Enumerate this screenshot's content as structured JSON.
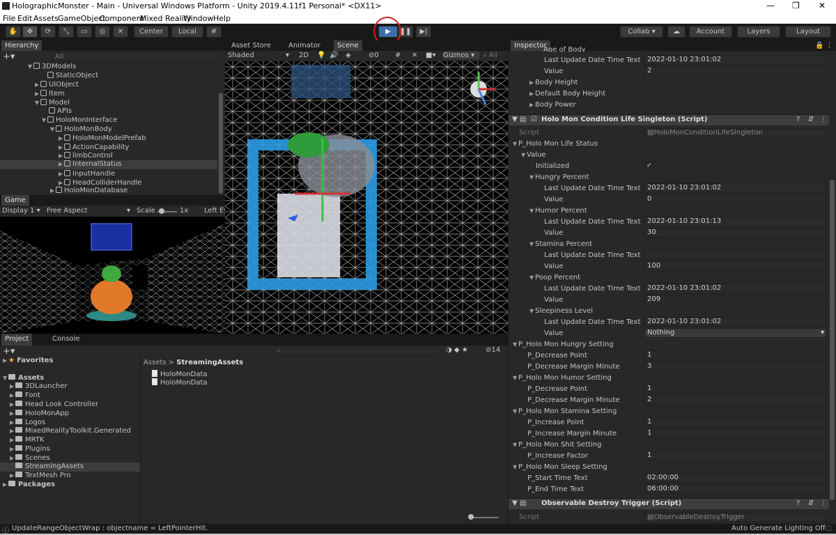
{
  "window": {
    "title": "HolographicMonster - Main - Universal Windows Platform - Unity 2019.4.11f1 Personal* <DX11>",
    "min": "—",
    "max": "❐",
    "close": "✕"
  },
  "menu": [
    "File",
    "Edit",
    "Assets",
    "GameObject",
    "Component",
    "Mixed Reality",
    "Window",
    "Help"
  ],
  "toolbar": {
    "center": "Center",
    "local": "Local",
    "collab": "Collab ▾",
    "account": "Account",
    "layers": "Layers",
    "layout": "Layout"
  },
  "hierarchy": {
    "tab": "Hierarchy",
    "search_placeholder": "All",
    "items": [
      "3DModels",
      "StaticObject",
      "UIObject",
      "Item",
      "Model",
      "APIs",
      "HoloMonInterface",
      "HoloMonBody",
      "HoloMonModelPrefab",
      "ActionCapability",
      "limbControl",
      "InternalStatus",
      "InputHandle",
      "HeadColliderHandle",
      "HoloMonDatabase"
    ]
  },
  "game": {
    "tab": "Game",
    "display": "Display 1",
    "aspect": "Free Aspect",
    "scale_label": "Scale",
    "scale_value": "1x",
    "left_eye": "Left Ey"
  },
  "scene": {
    "tabs": [
      "Asset Store",
      "Animator",
      "Scene"
    ],
    "shading": "Shaded",
    "mode2d": "2D",
    "hidden_count": "0",
    "gizmos": "Gizmos",
    "search_placeholder": "All"
  },
  "project": {
    "tabs": [
      "Project",
      "Console"
    ],
    "favorites": "Favorites",
    "assets_root": "Assets",
    "folders": [
      "3DLauncher",
      "Font",
      "Head Look Controller",
      "HoloMonApp",
      "Logos",
      "MixedRealityToolkit.Generated",
      "MRTK",
      "Plugins",
      "Scenes",
      "StreamingAssets",
      "TextMesh Pro"
    ],
    "packages": "Packages",
    "breadcrumb": [
      "Assets",
      "StreamingAssets"
    ],
    "files": [
      "HoloMonData",
      "HoloMonData"
    ],
    "hidden_count": "14"
  },
  "inspector": {
    "tab": "Inspector",
    "cut_label": "Age of Body",
    "rows_top": [
      {
        "label": "Last Update Date Time Text",
        "value": "2022-01-10 23:01:02"
      },
      {
        "label": "Value",
        "value": "2"
      }
    ],
    "foldouts_top": [
      "Body Height",
      "Default Body Height",
      "Body Power"
    ],
    "component1": "Holo Mon Condition Life Singleton (Script)",
    "script_label": "Script",
    "script1": "HoloMonConditionLifeSingleton",
    "life_status": "P_Holo Mon Life Status",
    "value_label": "Value",
    "initialized": "Initialized",
    "check": "✓",
    "groups": [
      {
        "name": "Hungry Percent",
        "date": "2022-01-10 23:01:02",
        "value": "0"
      },
      {
        "name": "Humor Percent",
        "date": "2022-01-10 23:01:13",
        "value": "30"
      },
      {
        "name": "Stamina Percent",
        "date": "",
        "value": "100"
      },
      {
        "name": "Poop Percent",
        "date": "2022-01-10 23:01:02",
        "value": "209"
      },
      {
        "name": "Sleepiness Level",
        "date": "2022-01-10 23:01:02",
        "value": "Nothing"
      }
    ],
    "last_update_label": "Last Update Date Time Text",
    "settings": [
      {
        "name": "P_Holo Mon Hungry Setting",
        "rows": [
          {
            "label": "P_Decrease Point",
            "value": "1"
          },
          {
            "label": "P_Decrease Margin Minute",
            "value": "3"
          }
        ]
      },
      {
        "name": "P_Holo Mon Humor Setting",
        "rows": [
          {
            "label": "P_Decrease Point",
            "value": "1"
          },
          {
            "label": "P_Decrease Margin Minute",
            "value": "2"
          }
        ]
      },
      {
        "name": "P_Holo Mon Stamina Setting",
        "rows": [
          {
            "label": "P_Increase Point",
            "value": "1"
          },
          {
            "label": "P_Increase Margin Minute",
            "value": "1"
          }
        ]
      },
      {
        "name": "P_Holo Mon Shit Setting",
        "rows": [
          {
            "label": "P_Increase Factor",
            "value": "1"
          }
        ]
      },
      {
        "name": "P_Holo Mon Sleep Setting",
        "rows": [
          {
            "label": "P_Start Time Text",
            "value": "02:00:00"
          },
          {
            "label": "P_End Time Text",
            "value": "06:00:00"
          }
        ]
      }
    ],
    "component2": "Observable Destroy Trigger (Script)",
    "script2": "ObservableDestroyTrigger"
  },
  "status": {
    "message": "UpdateRangeObjectWrap : objectname = LeftPointerHit.",
    "right": "Auto Generate Lighting Off"
  },
  "colors": {
    "selection": "#3d3d3d",
    "accent_ring": "#d21e1e",
    "play_active": "#3d6ea8",
    "scene_box": "#2a9be4"
  }
}
